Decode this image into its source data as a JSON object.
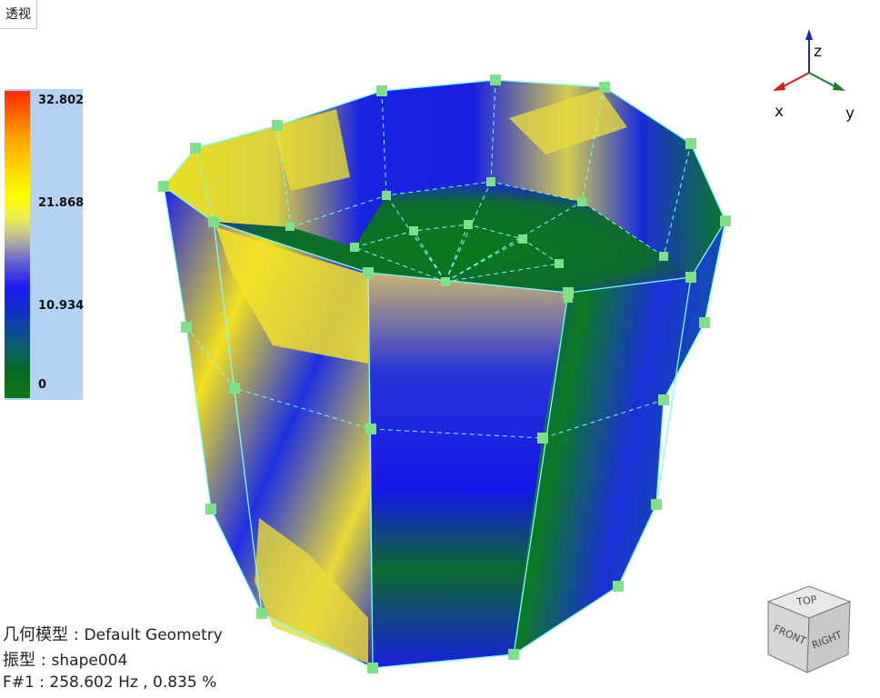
{
  "view_tab": {
    "label": "透视"
  },
  "legend": {
    "max": "32.802",
    "v2": "21.868",
    "v1": "10.934",
    "min": "0",
    "colors": [
      "#ff2a00",
      "#ffff00",
      "#1b1bf0",
      "#0b7a1a"
    ]
  },
  "info": {
    "model_label": "几何模型",
    "model_value": "Default Geometry",
    "shape_label": "振型",
    "shape_value": "shape004",
    "freq_label": "F#1",
    "freq_value": "258.602 Hz , 0.835 %"
  },
  "triad": {
    "x": "x",
    "y": "y",
    "z": "z"
  },
  "view_cube": {
    "top": "TOP",
    "front": "FRONT",
    "right": "RIGHT"
  },
  "accent": {
    "node": "#7fe08a",
    "edge": "#7fffff"
  }
}
